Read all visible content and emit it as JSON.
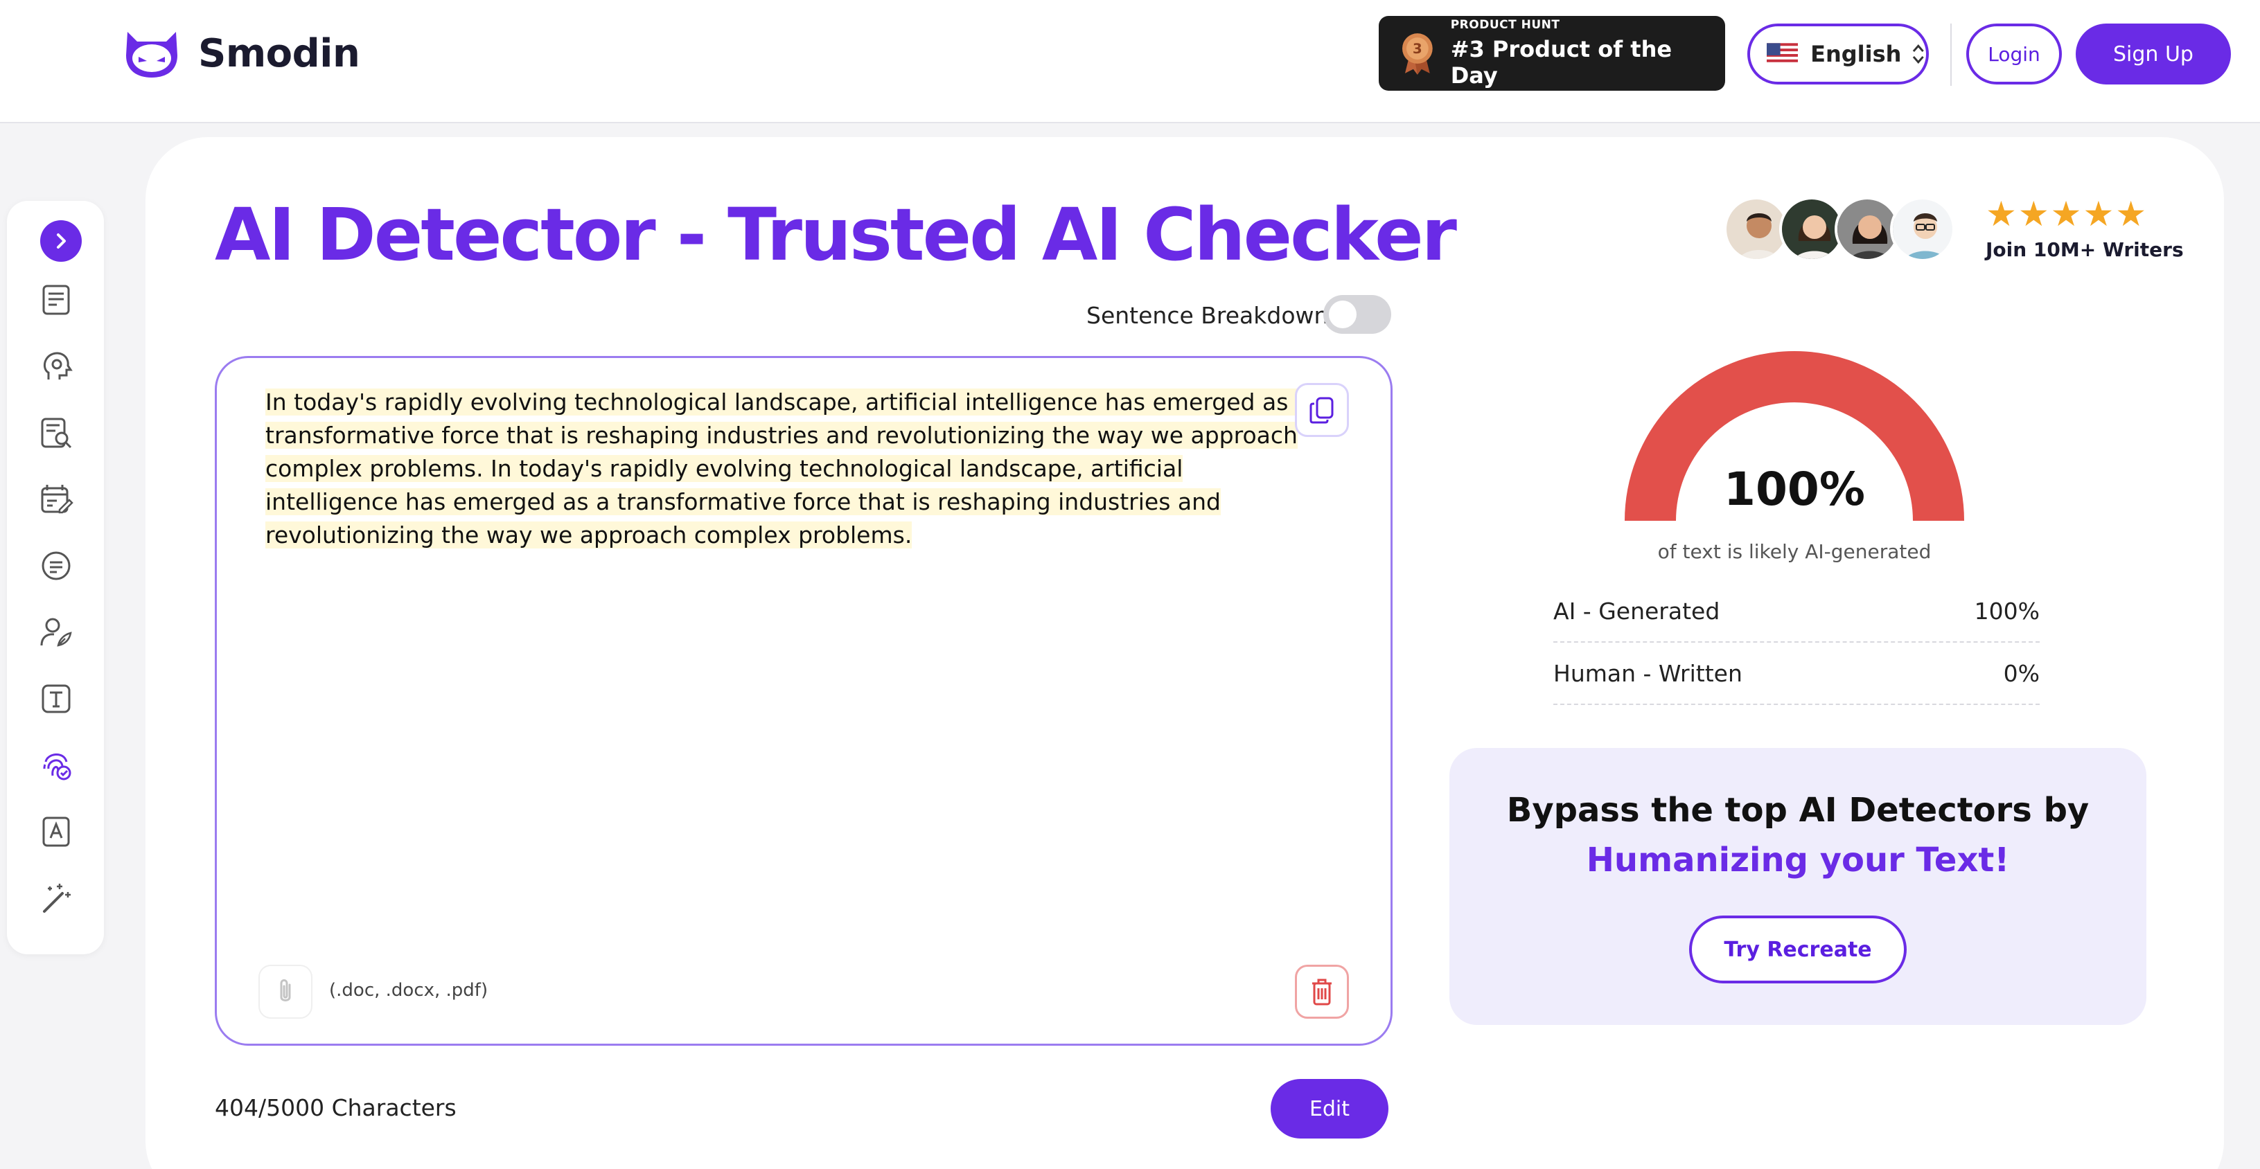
{
  "brand": {
    "name": "Smodin",
    "accent": "#6a2be6"
  },
  "header": {
    "product_hunt": {
      "small": "PRODUCT HUNT",
      "big": "#3 Product of the Day",
      "rank": "3"
    },
    "language": {
      "label": "English",
      "flag": "us-flag-icon"
    },
    "login_label": "Login",
    "signup_label": "Sign Up"
  },
  "sidebar": {
    "items": [
      {
        "icon": "chevron-right-icon"
      },
      {
        "icon": "document-lines-icon"
      },
      {
        "icon": "head-brain-icon"
      },
      {
        "icon": "document-search-icon"
      },
      {
        "icon": "calendar-edit-icon"
      },
      {
        "icon": "chat-lines-icon"
      },
      {
        "icon": "user-feather-icon"
      },
      {
        "icon": "text-box-icon"
      },
      {
        "icon": "fingerprint-check-icon"
      },
      {
        "icon": "document-letter-icon"
      },
      {
        "icon": "magic-wand-icon"
      }
    ]
  },
  "main": {
    "title": "AI Detector - Trusted AI Checker",
    "social": {
      "stars": "★★★★★",
      "join_label": "Join 10M+ Writers"
    },
    "sentence_breakdown_label": "Sentence Breakdown",
    "sentence_breakdown_on": false,
    "editor": {
      "text": "In today's rapidly evolving technological landscape, artificial intelligence has emerged as a transformative force that is reshaping industries and revolutionizing the way we approach complex problems. In today's rapidly evolving technological landscape, artificial intelligence has emerged as a transformative force that is reshaping industries and revolutionizing the way we approach complex problems.",
      "formats": "(.doc, .docx, .pdf)"
    },
    "char_count": "404/5000 Characters",
    "edit_label": "Edit"
  },
  "results": {
    "score": "100%",
    "score_fraction": 1.0,
    "caption": "of text is likely AI-generated",
    "gauge_color": "#e2504b",
    "rows": [
      {
        "label": "AI - Generated",
        "value": "100%"
      },
      {
        "label": "Human - Written",
        "value": "0%"
      }
    ]
  },
  "promo": {
    "line1": "Bypass the top AI Detectors by",
    "line2": "Humanizing your Text!",
    "button_label": "Try Recreate"
  }
}
